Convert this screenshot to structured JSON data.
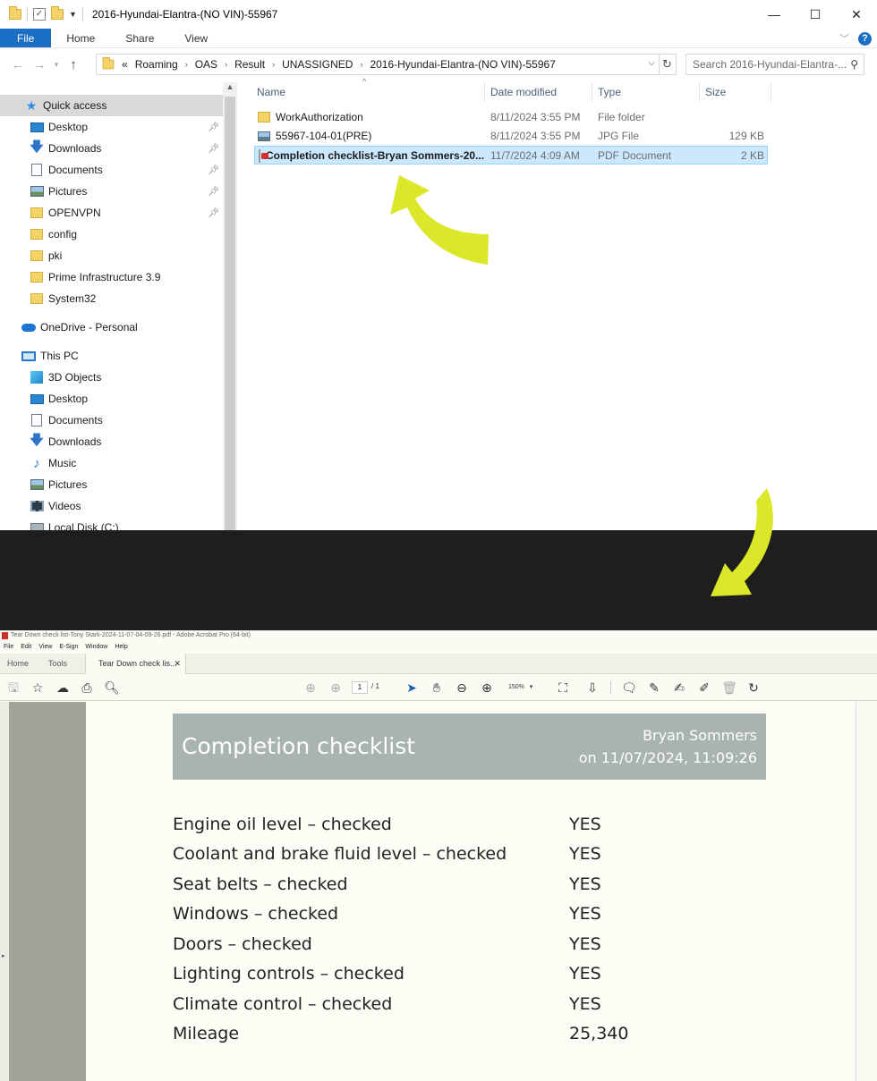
{
  "explorer": {
    "window_title": "2016-Hyundai-Elantra-(NO VIN)-55967",
    "ribbon_tabs": [
      "File",
      "Home",
      "Share",
      "View"
    ],
    "breadcrumb": [
      "«",
      "Roaming",
      "OAS",
      "Result",
      "UNASSIGNED",
      "2016-Hyundai-Elantra-(NO VIN)-55967"
    ],
    "search_placeholder": "Search 2016-Hyundai-Elantra-...",
    "nav": {
      "quick_access": "Quick access",
      "quick_items": [
        "Desktop",
        "Downloads",
        "Documents",
        "Pictures",
        "OPENVPN",
        "config",
        "pki",
        "Prime Infrastructure 3.9",
        "System32"
      ],
      "onedrive": "OneDrive - Personal",
      "this_pc": "This PC",
      "pc_items": [
        "3D Objects",
        "Desktop",
        "Documents",
        "Downloads",
        "Music",
        "Pictures",
        "Videos",
        "Local Disk (C:)"
      ]
    },
    "columns": [
      "Name",
      "Date modified",
      "Type",
      "Size"
    ],
    "files": [
      {
        "name": "WorkAuthorization",
        "date": "8/11/2024 3:55 PM",
        "type": "File folder",
        "size": ""
      },
      {
        "name": "55967-104-01(PRE)",
        "date": "8/11/2024 3:55 PM",
        "type": "JPG File",
        "size": "129 KB"
      },
      {
        "name": "Completion checklist-Bryan Sommers-20...",
        "date": "11/7/2024 4:09 AM",
        "type": "PDF Document",
        "size": "2 KB"
      }
    ]
  },
  "acrobat": {
    "title": "Tear Down check list-Tony Stark-2024-11-07-04-09-26.pdf - Adobe Acrobat Pro (64-bit)",
    "menu": [
      "File",
      "Edit",
      "View",
      "E-Sign",
      "Window",
      "Help"
    ],
    "tabs": [
      "Home",
      "Tools",
      "Tear Down check lis..."
    ],
    "page_current": "1",
    "page_total": "/ 1",
    "zoom": "150%",
    "document": {
      "title": "Completion checklist",
      "author": "Bryan Sommers",
      "date": "on 11/07/2024, 11:09:26",
      "rows": [
        {
          "label": "Engine oil level – checked",
          "value": "YES"
        },
        {
          "label": "Coolant and brake fluid level – checked",
          "value": "YES"
        },
        {
          "label": "Seat belts – checked",
          "value": "YES"
        },
        {
          "label": "Windows – checked",
          "value": "YES"
        },
        {
          "label": "Doors – checked",
          "value": "YES"
        },
        {
          "label": "Lighting controls – checked",
          "value": "YES"
        },
        {
          "label": "Climate control – checked",
          "value": "YES"
        },
        {
          "label": "Mileage",
          "value": "25,340"
        }
      ]
    }
  },
  "colors": {
    "accent_blue": "#1a6fc4",
    "selection": "#cce8ff",
    "annotation_arrow": "#dbe82a",
    "doc_header": "#a9b3b1"
  }
}
